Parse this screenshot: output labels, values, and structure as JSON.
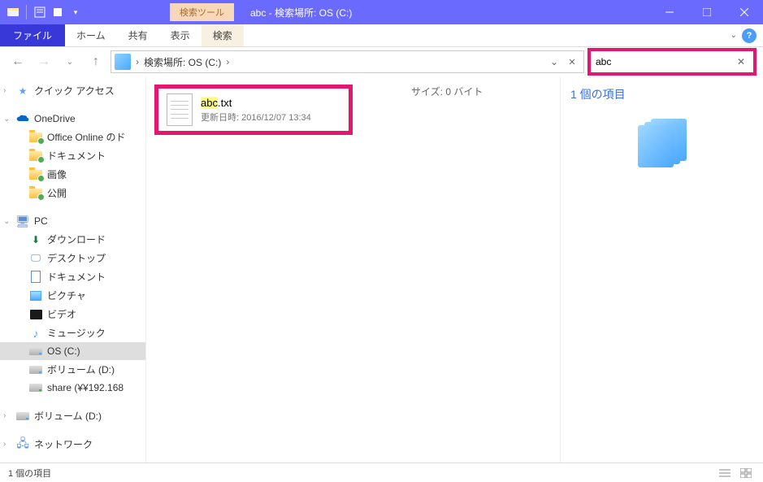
{
  "titlebar": {
    "context_tab": "検索ツール",
    "window_title": "abc - 検索場所: OS (C:)"
  },
  "ribbon": {
    "file": "ファイル",
    "home": "ホーム",
    "share": "共有",
    "view": "表示",
    "search": "検索"
  },
  "address": {
    "crumb1": "検索場所: OS (C:)"
  },
  "search": {
    "value": "abc"
  },
  "sidebar": {
    "quick_access": "クイック アクセス",
    "onedrive": "OneDrive",
    "office_online": "Office Online のド",
    "documents1": "ドキュメント",
    "pictures1": "画像",
    "public": "公開",
    "pc": "PC",
    "downloads": "ダウンロード",
    "desktop": "デスクトップ",
    "documents2": "ドキュメント",
    "pictures2": "ピクチャ",
    "videos": "ビデオ",
    "music": "ミュージック",
    "os_drive": "OS (C:)",
    "volume_d": "ボリューム (D:)",
    "share_net": "share (¥¥192.168",
    "volume_d2": "ボリューム (D:)",
    "network": "ネットワーク"
  },
  "results": {
    "file_highlight": "abc",
    "file_ext": ".txt",
    "updated_label": "更新日時:",
    "updated_value": "2016/12/07 13:34",
    "size_label": "サイズ:",
    "size_value": "0 バイト"
  },
  "preview": {
    "title": "1 個の項目"
  },
  "status": {
    "count": "1 個の項目"
  }
}
